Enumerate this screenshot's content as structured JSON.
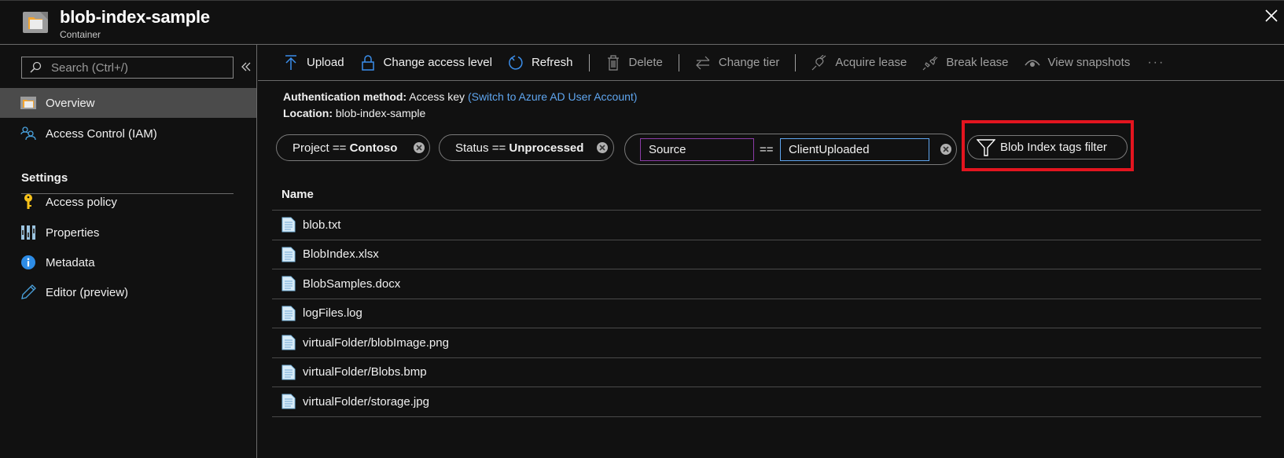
{
  "header": {
    "title": "blob-index-sample",
    "subtitle": "Container",
    "icon": "container-folder-icon",
    "close_icon": "close-icon"
  },
  "sidebar": {
    "search_placeholder": "Search (Ctrl+/)",
    "search_value": "",
    "collapse_icon": "double-chevron-left-icon",
    "items": [
      {
        "label": "Overview",
        "icon": "container-icon",
        "active": true
      },
      {
        "label": "Access Control (IAM)",
        "icon": "people-icon",
        "active": false
      }
    ],
    "settings_title": "Settings",
    "settings_items": [
      {
        "label": "Access policy",
        "icon": "key-icon"
      },
      {
        "label": "Properties",
        "icon": "properties-icon"
      },
      {
        "label": "Metadata",
        "icon": "info-icon"
      },
      {
        "label": "Editor (preview)",
        "icon": "pencil-icon"
      }
    ]
  },
  "toolbar": {
    "buttons": [
      {
        "label": "Upload",
        "icon": "upload-icon",
        "enabled": true
      },
      {
        "label": "Change access level",
        "icon": "lock-icon",
        "enabled": true
      },
      {
        "label": "Refresh",
        "icon": "refresh-icon",
        "enabled": true
      },
      {
        "label": "Delete",
        "icon": "trash-icon",
        "enabled": false
      },
      {
        "label": "Change tier",
        "icon": "swap-arrows-icon",
        "enabled": false
      },
      {
        "label": "Acquire lease",
        "icon": "plug-icon",
        "enabled": false
      },
      {
        "label": "Break lease",
        "icon": "unplug-icon",
        "enabled": false
      },
      {
        "label": "View snapshots",
        "icon": "eye-icon",
        "enabled": false
      }
    ],
    "more_label": "···"
  },
  "info": {
    "auth_label": "Authentication method:",
    "auth_value": "Access key",
    "auth_link": "(Switch to Azure AD User Account)",
    "location_label": "Location:",
    "location_value": "blob-index-sample"
  },
  "filters": {
    "tags": [
      {
        "key": "Project",
        "op": "==",
        "value": "Contoso"
      },
      {
        "key": "Status",
        "op": "==",
        "value": "Unprocessed"
      }
    ],
    "editing": {
      "key": "Source",
      "op": "==",
      "value": "ClientUploaded"
    },
    "filter_button_label": "Blob Index tags filter",
    "highlight_color": "#e3151f"
  },
  "table": {
    "columns": [
      "Name"
    ],
    "rows": [
      {
        "name": "blob.txt"
      },
      {
        "name": "BlobIndex.xlsx"
      },
      {
        "name": "BlobSamples.docx"
      },
      {
        "name": "logFiles.log"
      },
      {
        "name": "virtualFolder/blobImage.png"
      },
      {
        "name": "virtualFolder/Blobs.bmp"
      },
      {
        "name": "virtualFolder/storage.jpg"
      }
    ]
  }
}
